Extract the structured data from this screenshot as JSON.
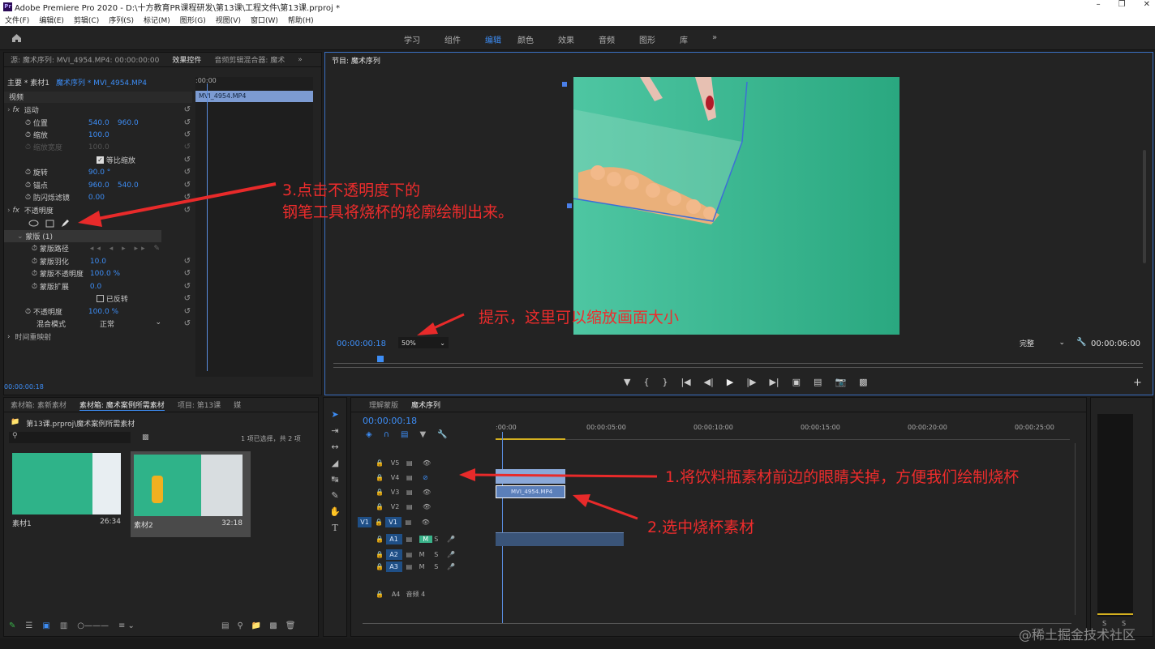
{
  "app": {
    "title": "Adobe Premiere Pro 2020 - D:\\十方教育PR课程研发\\第13课\\工程文件\\第13课.prproj *",
    "logo": "Pr"
  },
  "menu": [
    "文件(F)",
    "编辑(E)",
    "剪辑(C)",
    "序列(S)",
    "标记(M)",
    "图形(G)",
    "视图(V)",
    "窗口(W)",
    "帮助(H)"
  ],
  "workspaces": [
    "学习",
    "组件",
    "编辑",
    "颜色",
    "效果",
    "音频",
    "图形",
    "库"
  ],
  "effect_panel": {
    "tab_source": "源: 魔术序列: MVI_4954.MP4: 00:00:00:00",
    "tab_effects": "效果控件",
    "tab_mixer": "音频剪辑混合器: 魔术",
    "master": "主要 * 素材1",
    "seq": "魔术序列 * MVI_4954.MP4",
    "ruler_time": ":00:00",
    "clip_label": "MVI_4954.MP4",
    "video_label": "视频",
    "motion": "运动",
    "position": "位置",
    "position_x": "540.0",
    "position_y": "960.0",
    "scale": "缩放",
    "scale_v": "100.0",
    "scale_w": "缩放宽度",
    "scale_w_v": "100.0",
    "uniform": "等比缩放",
    "rotation": "旋转",
    "rotation_v": "90.0 °",
    "anchor": "锚点",
    "anchor_x": "960.0",
    "anchor_y": "540.0",
    "flicker": "防闪烁滤镜",
    "flicker_v": "0.00",
    "opacity": "不透明度",
    "mask": "蒙版 (1)",
    "mask_path": "蒙版路径",
    "mask_feather": "蒙版羽化",
    "mask_feather_v": "10.0",
    "mask_opacity": "蒙版不透明度",
    "mask_opacity_v": "100.0 %",
    "mask_expand": "蒙版扩展",
    "mask_expand_v": "0.0",
    "inverted": "已反转",
    "opacity2": "不透明度",
    "opacity2_v": "100.0 %",
    "blend": "混合模式",
    "blend_v": "正常",
    "remap": "时间重映射",
    "time": "00:00:00:18"
  },
  "program": {
    "title": "节目: 魔术序列",
    "timecode": "00:00:00:18",
    "zoom": "50%",
    "quality": "完整",
    "duration": "00:00:06:00"
  },
  "project": {
    "tab1": "素材箱: 素新素材",
    "tab2": "素材箱: 魔术案例所需素材",
    "tab3": "项目: 第13课",
    "tab4": "媒",
    "path": "第13课.prproj\\魔术案例所需素材",
    "count": "1 项已选择，共 2 项",
    "items": [
      {
        "name": "素材1",
        "duration": "26:34"
      },
      {
        "name": "素材2",
        "duration": "32:18"
      }
    ]
  },
  "timeline": {
    "tab1": "理解蒙版",
    "tab2": "魔术序列",
    "timecode": "00:00:00:18",
    "ticks": [
      ":00:00",
      "00:00:05:00",
      "00:00:10:00",
      "00:00:15:00",
      "00:00:20:00",
      "00:00:25:00"
    ],
    "video_tracks": [
      "V5",
      "V4",
      "V3",
      "V2",
      "V1"
    ],
    "audio_tracks": [
      "A1",
      "A2",
      "A3"
    ],
    "a4": "A4",
    "a4_name": "音频 4",
    "clip_v3": "MVI_4954.MP4",
    "v1_src": "V1"
  },
  "annotations": {
    "a1": "1.将饮料瓶素材前边的眼睛关掉，方便我们绘制烧杯",
    "a2": "2.选中烧杯素材",
    "a3_line1": "3.点击不透明度下的",
    "a3_line2": "钢笔工具将烧杯的轮廓绘制出来。",
    "tip": "提示，这里可以缩放画面大小"
  },
  "meter": {
    "s1": "S",
    "s2": "S"
  },
  "watermark": "@稀土掘金技术社区",
  "colors": {
    "accent": "#3d8df5",
    "annotation": "#ee2c2c",
    "screen": "#2fb389"
  }
}
